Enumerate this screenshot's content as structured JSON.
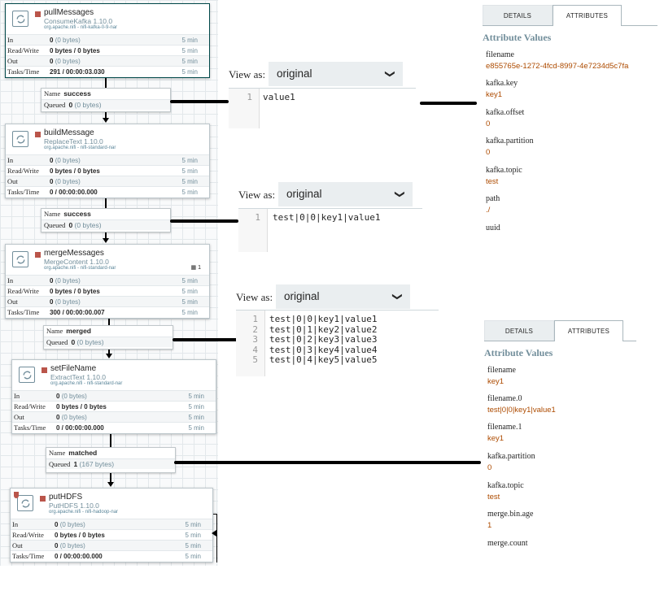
{
  "processors": [
    {
      "name": "pullMessages",
      "type": "ConsumeKafka 1.10.0",
      "bundle": "org.apache.nifi - nifi-kafka-0-9-nar",
      "stats": [
        {
          "label": "In",
          "value": "0",
          "detail": "(0 bytes)",
          "time": "5 min"
        },
        {
          "label": "Read/Write",
          "value": "0 bytes / 0 bytes",
          "detail": "",
          "time": "5 min"
        },
        {
          "label": "Out",
          "value": "0",
          "detail": "(0 bytes)",
          "time": "5 min"
        },
        {
          "label": "Tasks/Time",
          "value": "291 / 00:00:03.030",
          "detail": "",
          "time": "5 min"
        }
      ]
    },
    {
      "name": "buildMessage",
      "type": "ReplaceText 1.10.0",
      "bundle": "org.apache.nifi - nifi-standard-nar",
      "stats": [
        {
          "label": "In",
          "value": "0",
          "detail": "(0 bytes)",
          "time": "5 min"
        },
        {
          "label": "Read/Write",
          "value": "0 bytes / 0 bytes",
          "detail": "",
          "time": "5 min"
        },
        {
          "label": "Out",
          "value": "0",
          "detail": "(0 bytes)",
          "time": "5 min"
        },
        {
          "label": "Tasks/Time",
          "value": "0 / 00:00:00.000",
          "detail": "",
          "time": "5 min"
        }
      ]
    },
    {
      "name": "mergeMessages",
      "type": "MergeContent 1.10.0",
      "bundle": "org.apache.nifi - nifi-standard-nar",
      "indicator": "1",
      "stats": [
        {
          "label": "In",
          "value": "0",
          "detail": "(0 bytes)",
          "time": "5 min"
        },
        {
          "label": "Read/Write",
          "value": "0 bytes / 0 bytes",
          "detail": "",
          "time": "5 min"
        },
        {
          "label": "Out",
          "value": "0",
          "detail": "(0 bytes)",
          "time": "5 min"
        },
        {
          "label": "Tasks/Time",
          "value": "300 / 00:00:00.007",
          "detail": "",
          "time": "5 min"
        }
      ]
    },
    {
      "name": "setFileName",
      "type": "ExtractText 1.10.0",
      "bundle": "org.apache.nifi - nifi-standard-nar",
      "stats": [
        {
          "label": "In",
          "value": "0",
          "detail": "(0 bytes)",
          "time": "5 min"
        },
        {
          "label": "Read/Write",
          "value": "0 bytes / 0 bytes",
          "detail": "",
          "time": "5 min"
        },
        {
          "label": "Out",
          "value": "0",
          "detail": "(0 bytes)",
          "time": "5 min"
        },
        {
          "label": "Tasks/Time",
          "value": "0 / 00:00:00.000",
          "detail": "",
          "time": "5 min"
        }
      ]
    },
    {
      "name": "putHDFS",
      "type": "PutHDFS 1.10.0",
      "bundle": "org.apache.nifi - nifi-hadoop-nar",
      "stats": [
        {
          "label": "In",
          "value": "0",
          "detail": "(0 bytes)",
          "time": "5 min"
        },
        {
          "label": "Read/Write",
          "value": "0 bytes / 0 bytes",
          "detail": "",
          "time": "5 min"
        },
        {
          "label": "Out",
          "value": "0",
          "detail": "(0 bytes)",
          "time": "5 min"
        },
        {
          "label": "Tasks/Time",
          "value": "0 / 00:00:00.000",
          "detail": "",
          "time": "5 min"
        }
      ]
    }
  ],
  "connections": [
    {
      "name_label": "Name",
      "name": "success",
      "queued_label": "Queued",
      "count": "0",
      "size": "(0 bytes)"
    },
    {
      "name_label": "Name",
      "name": "success",
      "queued_label": "Queued",
      "count": "0",
      "size": "(0 bytes)"
    },
    {
      "name_label": "Name",
      "name": "merged",
      "queued_label": "Queued",
      "count": "0",
      "size": "(0 bytes)"
    },
    {
      "name_label": "Name",
      "name": "matched",
      "queued_label": "Queued",
      "count": "1",
      "size": "(167 bytes)"
    }
  ],
  "viewers": [
    {
      "label": "View as:",
      "selected": "original",
      "lines": [
        {
          "n": "1",
          "text": "value1"
        }
      ]
    },
    {
      "label": "View as:",
      "selected": "original",
      "lines": [
        {
          "n": "1",
          "text": "test|0|0|key1|value1"
        }
      ]
    },
    {
      "label": "View as:",
      "selected": "original",
      "lines": [
        {
          "n": "1",
          "text": "test|0|0|key1|value1"
        },
        {
          "n": "2",
          "text": "test|0|1|key2|value2"
        },
        {
          "n": "3",
          "text": "test|0|2|key3|value3"
        },
        {
          "n": "4",
          "text": "test|0|3|key4|value4"
        },
        {
          "n": "5",
          "text": "test|0|4|key5|value5"
        }
      ]
    }
  ],
  "attribute_panels": [
    {
      "tab_details": "DETAILS",
      "tab_attributes": "ATTRIBUTES",
      "title": "Attribute Values",
      "attributes": [
        {
          "name": "filename",
          "value": "e855765e-1272-4fcd-8997-4e7234d5c7fa"
        },
        {
          "name": "kafka.key",
          "value": "key1"
        },
        {
          "name": "kafka.offset",
          "value": "0"
        },
        {
          "name": "kafka.partition",
          "value": "0"
        },
        {
          "name": "kafka.topic",
          "value": "test"
        },
        {
          "name": "path",
          "value": "./"
        },
        {
          "name": "uuid",
          "value": ""
        }
      ]
    },
    {
      "tab_details": "DETAILS",
      "tab_attributes": "ATTRIBUTES",
      "title": "Attribute Values",
      "attributes": [
        {
          "name": "filename",
          "value": "key1"
        },
        {
          "name": "filename.0",
          "value": "test|0|0|key1|value1"
        },
        {
          "name": "filename.1",
          "value": "key1"
        },
        {
          "name": "kafka.partition",
          "value": "0"
        },
        {
          "name": "kafka.topic",
          "value": "test"
        },
        {
          "name": "merge.bin.age",
          "value": "1"
        },
        {
          "name": "merge.count",
          "value": ""
        }
      ]
    }
  ],
  "colors": {
    "accent": "#728e9b",
    "stopped": "#ba554a",
    "attribute_value": "#ad4b00",
    "teal": "#004849"
  }
}
